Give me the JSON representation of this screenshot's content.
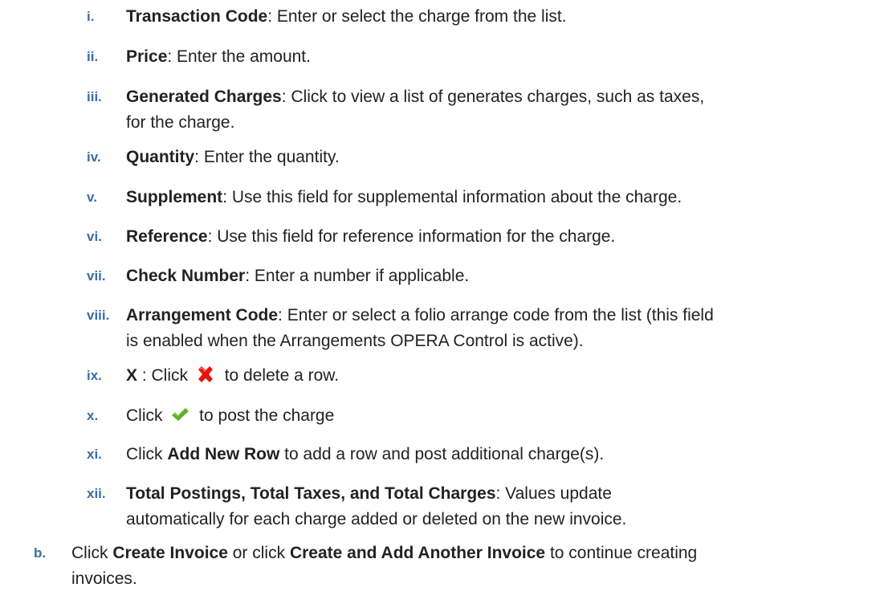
{
  "items": [
    {
      "marker": "i.",
      "term": "Transaction Code",
      "text": ": Enter or select the charge from the list."
    },
    {
      "marker": "ii.",
      "term": "Price",
      "text": ": Enter the amount."
    },
    {
      "marker": "iii.",
      "term": "Generated Charges",
      "text": ": Click to view a list of generates charges, such as taxes,",
      "text2": "for the charge."
    },
    {
      "marker": "iv.",
      "term": "Quantity",
      "text": ": Enter the quantity."
    },
    {
      "marker": "v.",
      "term": "Supplement",
      "text": ": Use this field for supplemental information about the charge."
    },
    {
      "marker": "vi.",
      "term": "Reference",
      "text": ": Use this field for reference information for the charge."
    },
    {
      "marker": "vii.",
      "term": "Check Number",
      "text": ": Enter a number if applicable."
    },
    {
      "marker": "viii.",
      "term": "Arrangement Code",
      "text": ": Enter or select a folio arrange code from the list (this field",
      "text2": "is enabled when the Arrangements OPERA Control is active)."
    },
    {
      "marker": "ix.",
      "term": "X",
      "text_before": " : Click ",
      "icon": "delete-x-icon",
      "icon_color": "#e8140c",
      "text_after": " to delete a row."
    },
    {
      "marker": "x.",
      "text_before": "Click ",
      "icon": "checkmark-icon",
      "icon_color": "#5fb12b",
      "text_after": " to post the charge"
    },
    {
      "marker": "xi.",
      "text_before": "Click ",
      "term": "Add New Row",
      "text_after": " to add a row and post additional charge(s)."
    },
    {
      "marker": "xii.",
      "term": "Total Postings, Total Taxes, and Total Charges",
      "text": ": Values update",
      "text2": "automatically for each charge added or deleted on the new invoice."
    }
  ],
  "step_b": {
    "marker": "b.",
    "text_before": "Click ",
    "term1": "Create Invoice",
    "text_mid": " or click ",
    "term2": "Create and Add Another Invoice",
    "text_after": " to continue creating",
    "text2": "invoices."
  },
  "colors": {
    "marker": "#3a6ea5",
    "text": "#222222"
  }
}
